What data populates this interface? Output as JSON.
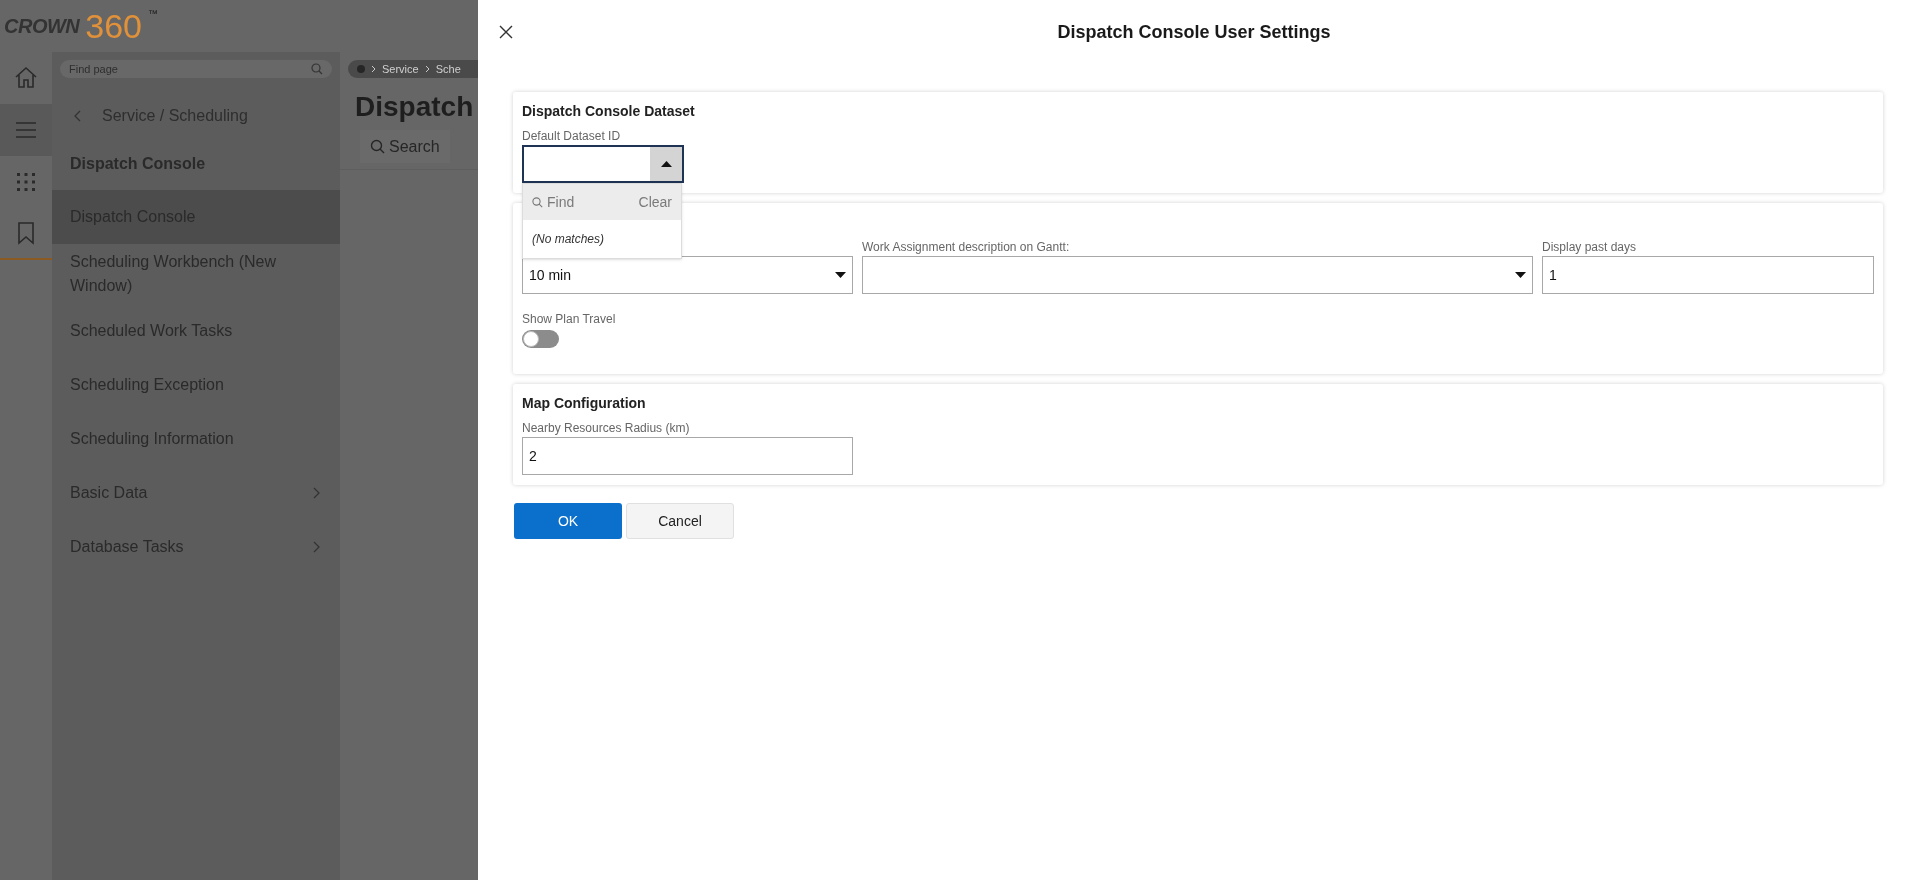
{
  "app": {
    "logo_word": "CROWN",
    "logo_number": "360",
    "logo_mark": "™"
  },
  "rail": [
    {
      "selected": false
    },
    {
      "selected": true
    },
    {
      "selected": false
    },
    {
      "selected": false
    }
  ],
  "nav": {
    "search_placeholder": "Find page",
    "back_label": "Service / Scheduling",
    "heading": "Dispatch Console",
    "items": [
      {
        "label": "Dispatch Console",
        "selected": true,
        "has_children": false
      },
      {
        "label": "Scheduling Workbench (New Window)",
        "selected": false,
        "has_children": false
      },
      {
        "label": "Scheduled Work Tasks",
        "selected": false,
        "has_children": false
      },
      {
        "label": "Scheduling Exception",
        "selected": false,
        "has_children": false
      },
      {
        "label": "Scheduling Information",
        "selected": false,
        "has_children": false
      },
      {
        "label": "Basic Data",
        "selected": false,
        "has_children": true
      },
      {
        "label": "Database Tasks",
        "selected": false,
        "has_children": true
      }
    ]
  },
  "page": {
    "breadcrumb": [
      "Service",
      "Sche"
    ],
    "title": "Dispatch",
    "search_button": "Search"
  },
  "dialog": {
    "title": "Dispatch Console User Settings",
    "sections": [
      {
        "title": "Dispatch Console Dataset",
        "fields": [
          {
            "kind": "combo",
            "label": "Default Dataset ID",
            "expanded": true
          }
        ]
      },
      {
        "fields": [
          {
            "kind": "select",
            "value": "10 min"
          },
          {
            "kind": "select",
            "label": "Work Assignment description on Gantt:"
          },
          {
            "kind": "text",
            "label": "Display past days",
            "value": "1"
          },
          {
            "kind": "toggle",
            "label": "Show Plan Travel",
            "on": false
          }
        ]
      },
      {
        "title": "Map Configuration",
        "fields": [
          {
            "kind": "text",
            "label": "Nearby Resources Radius (km)",
            "value": "2"
          }
        ]
      }
    ],
    "dropdown": {
      "find_placeholder": "Find",
      "clear": "Clear",
      "empty_text": "(No matches)"
    },
    "buttons": [
      {
        "label": "OK",
        "primary": true
      },
      {
        "label": "Cancel",
        "primary": false
      }
    ]
  }
}
